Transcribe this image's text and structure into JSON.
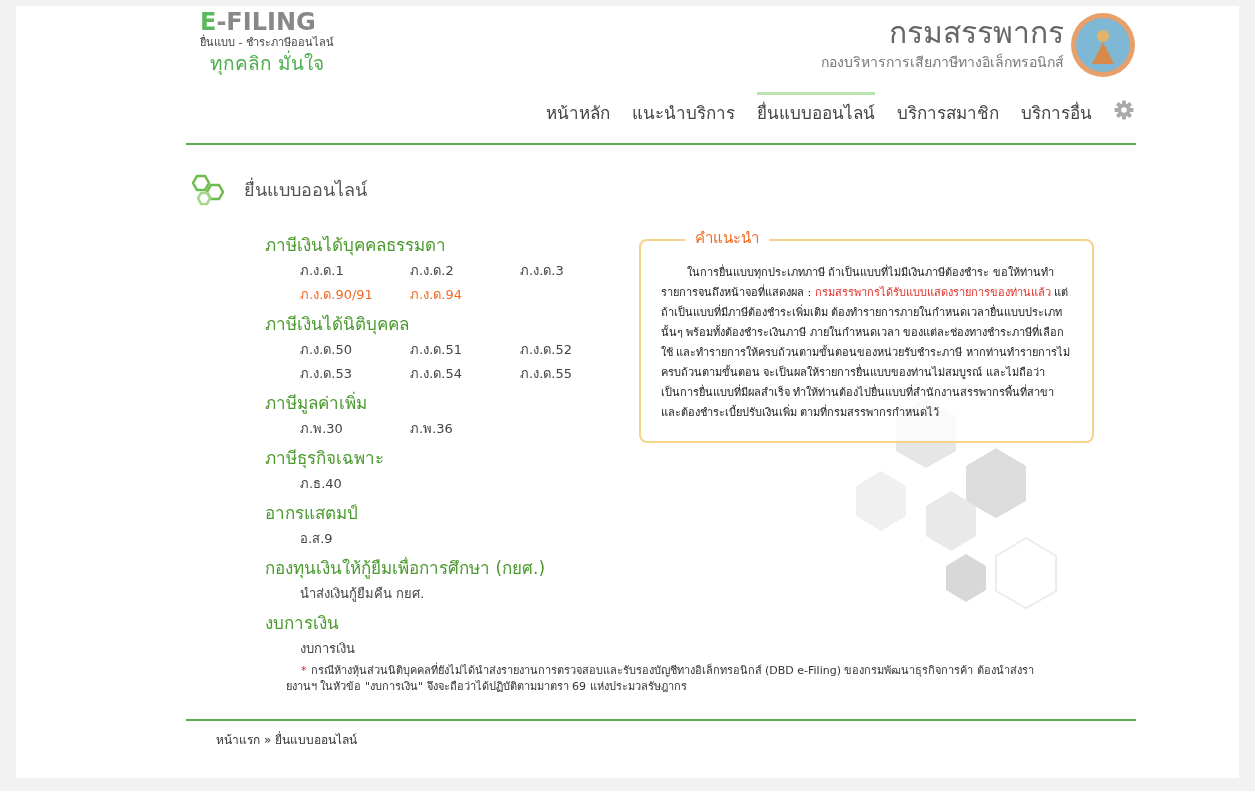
{
  "logo": {
    "mark": "E",
    "name": "-FILING",
    "subtitle": "ยื่นแบบ - ชำระภาษีออนไลน์",
    "slogan": "ทุกคลิก มั่นใจ"
  },
  "agency": {
    "name": "กรมสรรพากร",
    "division": "กองบริหารการเสียภาษีทางอิเล็กทรอนิกส์"
  },
  "nav": [
    {
      "label": "หน้าหลัก",
      "selected": false
    },
    {
      "label": "แนะนำบริการ",
      "selected": false
    },
    {
      "label": "ยื่นแบบออนไลน์",
      "selected": true
    },
    {
      "label": "บริการสมาชิก",
      "selected": false
    },
    {
      "label": "บริการอื่น",
      "selected": false
    }
  ],
  "page_title": "ยื่นแบบออนไลน์",
  "categories": [
    {
      "title": "ภาษีเงินได้บุคคลธรรมดา",
      "items": [
        {
          "label": "ภ.ง.ด.1",
          "highlight": false
        },
        {
          "label": "ภ.ง.ด.2",
          "highlight": false
        },
        {
          "label": "ภ.ง.ด.3",
          "highlight": false
        },
        {
          "label": "ภ.ง.ด.90/91",
          "highlight": true
        },
        {
          "label": "ภ.ง.ด.94",
          "highlight": true
        }
      ]
    },
    {
      "title": "ภาษีเงินได้นิติบุคคล",
      "items": [
        {
          "label": "ภ.ง.ด.50",
          "highlight": false
        },
        {
          "label": "ภ.ง.ด.51",
          "highlight": false
        },
        {
          "label": "ภ.ง.ด.52",
          "highlight": false
        },
        {
          "label": "ภ.ง.ด.53",
          "highlight": false
        },
        {
          "label": "ภ.ง.ด.54",
          "highlight": false
        },
        {
          "label": "ภ.ง.ด.55",
          "highlight": false
        }
      ]
    },
    {
      "title": "ภาษีมูลค่าเพิ่ม",
      "items": [
        {
          "label": "ภ.พ.30",
          "highlight": false
        },
        {
          "label": "ภ.พ.36",
          "highlight": false
        }
      ]
    },
    {
      "title": "ภาษีธุรกิจเฉพาะ",
      "items": [
        {
          "label": "ภ.ธ.40",
          "highlight": false
        }
      ]
    },
    {
      "title": "อากรแสตมป์",
      "items": [
        {
          "label": "อ.ส.9",
          "highlight": false
        }
      ]
    },
    {
      "title": "กองทุนเงินให้กู้ยืมเพื่อการศึกษา (กยศ.)",
      "items": [
        {
          "label": "นำส่งเงินกู้ยืมคืน กยศ.",
          "highlight": false
        }
      ]
    },
    {
      "title": "งบการเงิน",
      "items": [
        {
          "label": "งบการเงิน",
          "highlight": false
        }
      ]
    }
  ],
  "note": {
    "mark": "*",
    "text": "กรณีห้างหุ้นส่วนนิติบุคคลที่ยังไม่ได้นำส่งรายงานการตรวจสอบและรับรองบัญชีทางอิเล็กทรอนิกส์ (DBD e-Filing) ของกรมพัฒนาธุรกิจการค้า ต้องนำส่งรายงานฯ ในหัวข้อ \"งบการเงิน\" จึงจะถือว่าได้ปฏิบัติตามมาตรา 69 แห่งประมวลรัษฎากร"
  },
  "instructions": {
    "title": "คำแนะนำ",
    "segments": [
      {
        "text": "ในการยื่นแบบทุกประเภทภาษี ถ้าเป็นแบบที่ไม่มีเงินภาษีต้องชำระ ขอให้ท่านทำรายการจนถึงหน้าจอที่แสดงผล : ",
        "highlight": false
      },
      {
        "text": "กรมสรรพากรได้รับแบบแสดงรายการของท่านแล้ว",
        "highlight": true
      },
      {
        "text": " แต่ถ้าเป็นแบบที่มีภาษีต้องชำระเพิ่มเติม ต้องทำรายการภายในกำหนดเวลายื่นแบบประเภทนั้นๆ พร้อมทั้งต้องชำระเงินภาษี ภายในกำหนดเวลา ของแต่ละช่องทางชำระภาษีที่เลือกใช้ และทำรายการให้ครบถ้วนตามขั้นตอนของหน่วยรับชำระภาษี หากท่านทำรายการไม่ครบถ้วนตามขั้นตอน จะเป็นผลให้รายการยื่นแบบของท่านไม่สมบูรณ์ และไม่ถือว่าเป็นการยื่นแบบที่มีผลสำเร็จ ทำให้ท่านต้องไปยื่นแบบที่สำนักงานสรรพากรพื้นที่สาขาและต้องชำระเบี้ยปรับเงินเพิ่ม ตามที่กรมสรรพากรกำหนดไว้",
        "highlight": false
      }
    ]
  },
  "breadcrumb": [
    "หน้าแรก",
    "»",
    "ยื่นแบบออนไลน์"
  ]
}
